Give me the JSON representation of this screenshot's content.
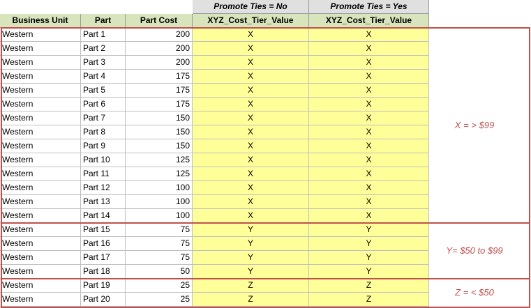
{
  "header": {
    "promote_no": "Promote Ties = No",
    "promote_yes": "Promote Ties = Yes",
    "business_unit": "Business Unit",
    "part": "Part",
    "part_cost": "Part Cost",
    "tier_no": "XYZ_Cost_Tier_Value",
    "tier_yes": "XYZ_Cost_Tier_Value"
  },
  "rows": [
    {
      "bu": "Western",
      "part": "Part 1",
      "cost": "200",
      "no": "X",
      "yes": "X"
    },
    {
      "bu": "Western",
      "part": "Part 2",
      "cost": "200",
      "no": "X",
      "yes": "X"
    },
    {
      "bu": "Western",
      "part": "Part 3",
      "cost": "200",
      "no": "X",
      "yes": "X"
    },
    {
      "bu": "Western",
      "part": "Part 4",
      "cost": "175",
      "no": "X",
      "yes": "X"
    },
    {
      "bu": "Western",
      "part": "Part 5",
      "cost": "175",
      "no": "X",
      "yes": "X"
    },
    {
      "bu": "Western",
      "part": "Part 6",
      "cost": "175",
      "no": "X",
      "yes": "X"
    },
    {
      "bu": "Western",
      "part": "Part 7",
      "cost": "150",
      "no": "X",
      "yes": "X"
    },
    {
      "bu": "Western",
      "part": "Part 8",
      "cost": "150",
      "no": "X",
      "yes": "X"
    },
    {
      "bu": "Western",
      "part": "Part 9",
      "cost": "150",
      "no": "X",
      "yes": "X"
    },
    {
      "bu": "Western",
      "part": "Part 10",
      "cost": "125",
      "no": "X",
      "yes": "X"
    },
    {
      "bu": "Western",
      "part": "Part 11",
      "cost": "125",
      "no": "X",
      "yes": "X"
    },
    {
      "bu": "Western",
      "part": "Part 12",
      "cost": "100",
      "no": "X",
      "yes": "X"
    },
    {
      "bu": "Western",
      "part": "Part 13",
      "cost": "100",
      "no": "X",
      "yes": "X"
    },
    {
      "bu": "Western",
      "part": "Part 14",
      "cost": "100",
      "no": "X",
      "yes": "X"
    },
    {
      "bu": "Western",
      "part": "Part 15",
      "cost": "75",
      "no": "Y",
      "yes": "Y"
    },
    {
      "bu": "Western",
      "part": "Part 16",
      "cost": "75",
      "no": "Y",
      "yes": "Y"
    },
    {
      "bu": "Western",
      "part": "Part 17",
      "cost": "75",
      "no": "Y",
      "yes": "Y"
    },
    {
      "bu": "Western",
      "part": "Part 18",
      "cost": "50",
      "no": "Y",
      "yes": "Y"
    },
    {
      "bu": "Western",
      "part": "Part 19",
      "cost": "25",
      "no": "Z",
      "yes": "Z"
    },
    {
      "bu": "Western",
      "part": "Part 20",
      "cost": "25",
      "no": "Z",
      "yes": "Z"
    }
  ],
  "groups": [
    {
      "label": "X = > $99"
    },
    {
      "label": "Y= $50 to $99"
    },
    {
      "label": "Z = < $50"
    }
  ],
  "colors": {
    "header_green": "#d8e4bc",
    "header_gray": "#e0e0e0",
    "highlight_yellow": "#ffff99",
    "group_border": "#c0504d"
  }
}
